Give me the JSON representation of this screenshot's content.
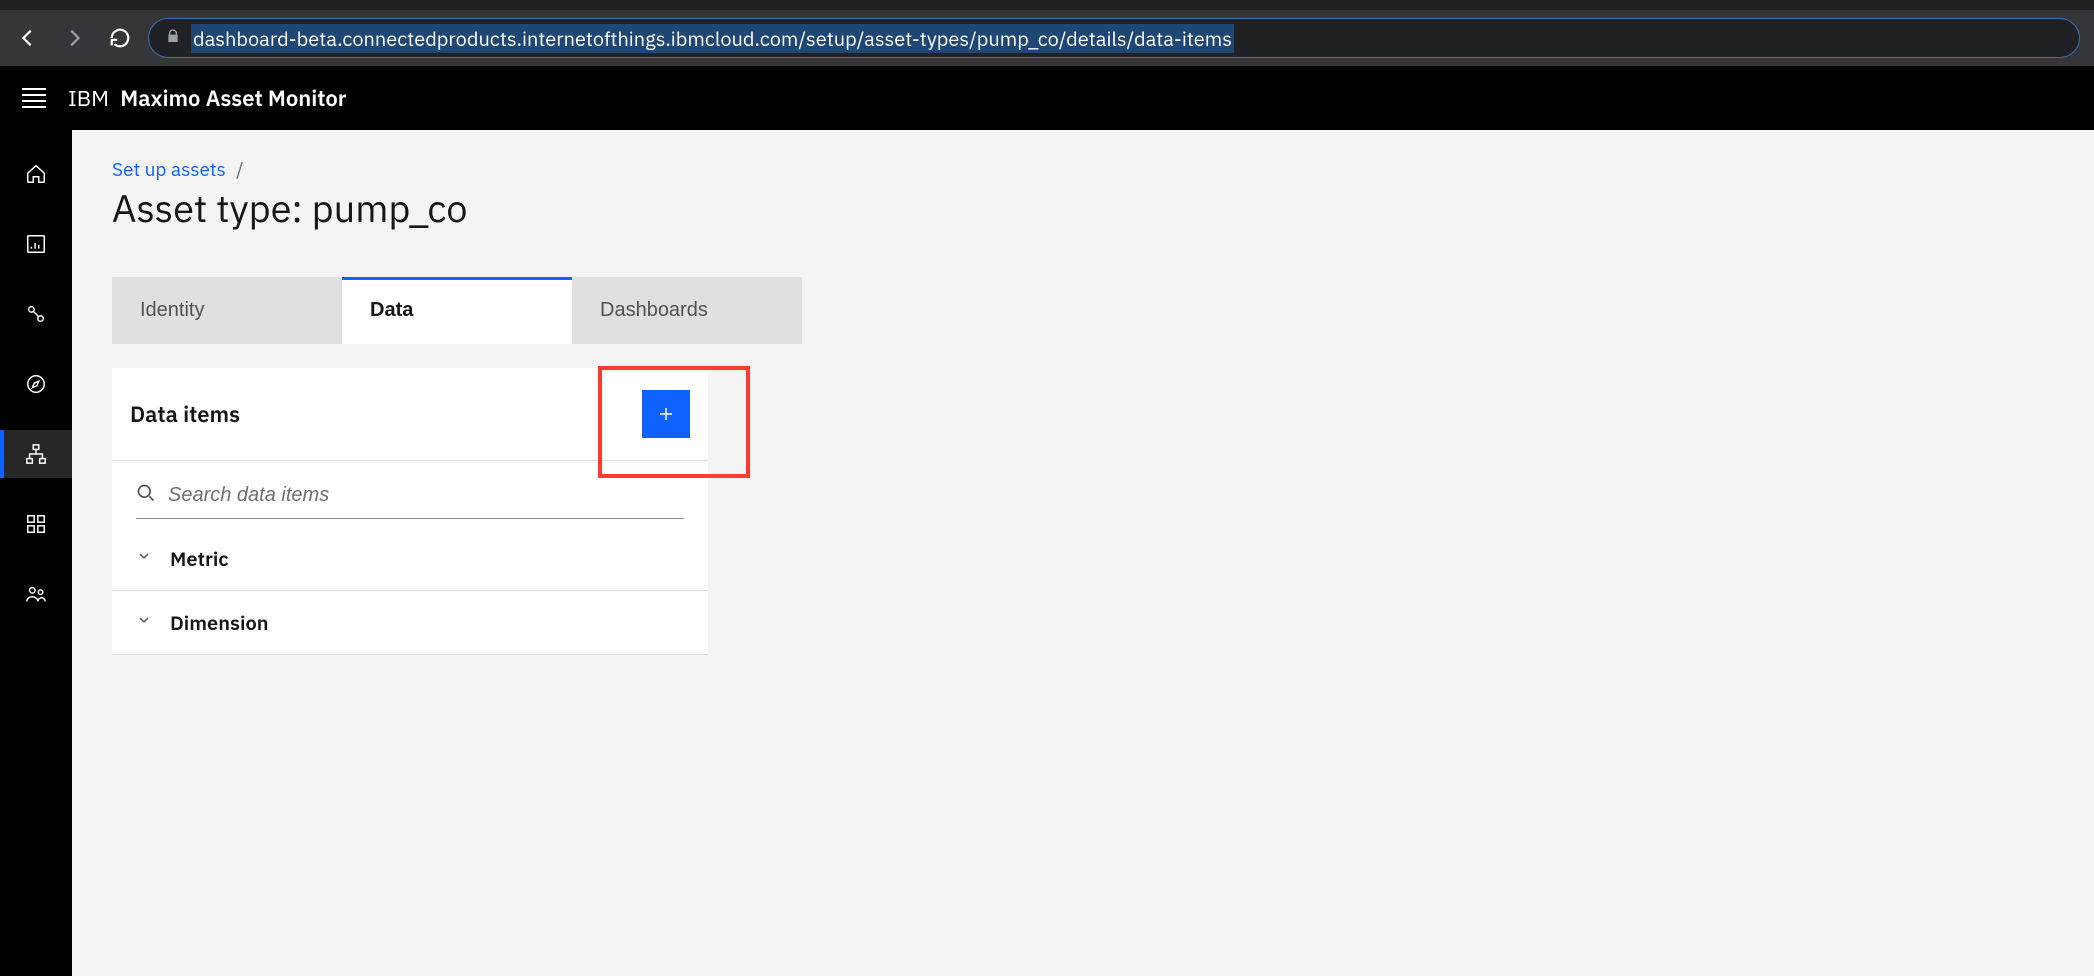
{
  "browser": {
    "url": "dashboard-beta.connectedproducts.internetofthings.ibmcloud.com/setup/asset-types/pump_co/details/data-items"
  },
  "header": {
    "brand_prefix": "IBM",
    "product": "Maximo Asset Monitor"
  },
  "breadcrumb": {
    "parent": "Set up assets",
    "separator": "/",
    "title": "Asset type: pump_co"
  },
  "tabs": [
    {
      "label": "Identity",
      "active": false
    },
    {
      "label": "Data",
      "active": true
    },
    {
      "label": "Dashboards",
      "active": false
    }
  ],
  "panel": {
    "heading": "Data items",
    "search_placeholder": "Search data items",
    "categories": [
      {
        "label": "Metric"
      },
      {
        "label": "Dimension"
      }
    ]
  }
}
